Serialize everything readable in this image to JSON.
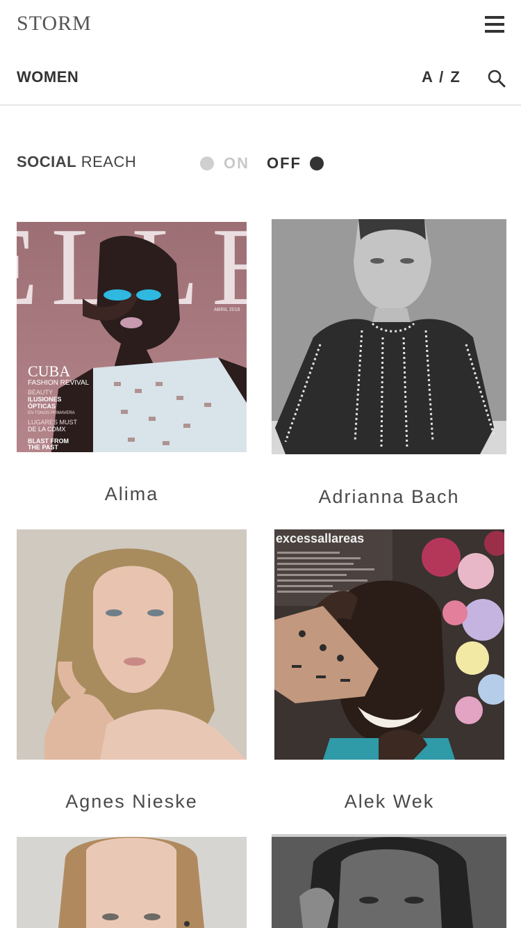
{
  "header": {
    "logo": "STORM"
  },
  "nav": {
    "category": "WOMEN",
    "sort": "A / Z"
  },
  "social_reach": {
    "label_bold": "SOCIAL",
    "label_rest": " REACH",
    "on_label": "ON",
    "off_label": "OFF"
  },
  "models": [
    {
      "name": "Alima",
      "cover": {
        "masthead": "ELLE",
        "date": "ABRIL 2016",
        "headline": "CUBA",
        "sub": "FASHION REVIVAL",
        "lines": [
          "BEAUTY",
          "ILUSIONES",
          "ÓPTICAS",
          "EN TONOS PRIMAVERA",
          "LUGARES MUST",
          "DE LA CDMX",
          "BLAST FROM",
          "THE PAST"
        ]
      }
    },
    {
      "name": "Adrianna Bach"
    },
    {
      "name": "Agnes Nieske"
    },
    {
      "name": "Alek Wek",
      "cover": {
        "masthead": "excessallareas"
      }
    },
    {
      "name": ""
    },
    {
      "name": ""
    }
  ]
}
